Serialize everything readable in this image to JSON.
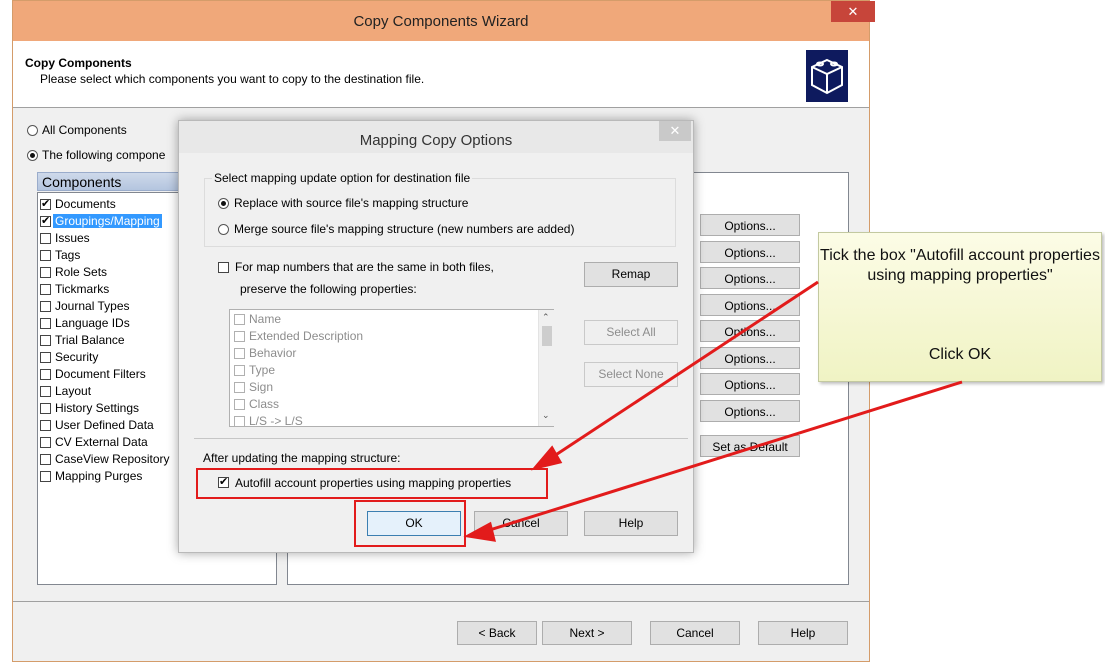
{
  "wizard": {
    "title": "Copy Components Wizard",
    "close": "✕",
    "header_title": "Copy Components",
    "header_subtitle": "Please select which components you want to copy to the destination file.",
    "radio_all": "All Components",
    "radio_following": "The following compone",
    "components_header": "Components",
    "components": [
      {
        "label": "Documents",
        "checked": true
      },
      {
        "label": "Groupings/Mapping",
        "checked": true
      },
      {
        "label": "Issues",
        "checked": false
      },
      {
        "label": "Tags",
        "checked": false
      },
      {
        "label": "Role Sets",
        "checked": false
      },
      {
        "label": "Tickmarks",
        "checked": false
      },
      {
        "label": "Journal Types",
        "checked": false
      },
      {
        "label": "Language IDs",
        "checked": false
      },
      {
        "label": "Trial Balance",
        "checked": false
      },
      {
        "label": "Security",
        "checked": false
      },
      {
        "label": "Document Filters",
        "checked": false
      },
      {
        "label": "Layout",
        "checked": false
      },
      {
        "label": "History Settings",
        "checked": false
      },
      {
        "label": "User Defined Data",
        "checked": false
      },
      {
        "label": "CV External Data",
        "checked": false
      },
      {
        "label": "CaseView Repository",
        "checked": false
      },
      {
        "label": "Mapping Purges",
        "checked": false
      }
    ],
    "options_label": "Options...",
    "set_default": "Set as Default",
    "back": "< Back",
    "next": "Next >",
    "cancel": "Cancel",
    "help": "Help"
  },
  "mapping": {
    "title": "Mapping Copy Options",
    "close": "✕",
    "group_label": "Select mapping update option for destination file",
    "opt_replace": "Replace with source file's mapping structure",
    "opt_merge": "Merge source file's mapping structure (new numbers are added)",
    "preserve_line1": "For map numbers that are the same in both files,",
    "preserve_line2": "preserve the following properties:",
    "remap": "Remap",
    "select_all": "Select All",
    "select_none": "Select None",
    "properties": [
      "Name",
      "Extended Description",
      "Behavior",
      "Type",
      "Sign",
      "Class",
      "L/S -> L/S"
    ],
    "after_label": "After updating the mapping structure:",
    "autofill": "Autofill account properties using mapping properties",
    "ok": "OK",
    "cancel": "Cancel",
    "help": "Help"
  },
  "callout": {
    "line1": "Tick the box \"Autofill account properties using mapping properties\"",
    "line2": "Click OK"
  }
}
